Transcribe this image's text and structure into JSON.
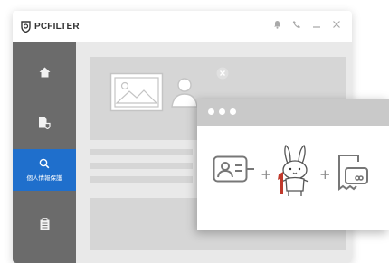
{
  "app": {
    "name": "PCFILTER"
  },
  "sidebar": {
    "items": [
      {
        "icon": "home-icon"
      },
      {
        "icon": "file-shield-icon"
      },
      {
        "icon": "search-icon",
        "label": "個人情報保護",
        "active": true
      },
      {
        "icon": "clipboard-icon"
      }
    ]
  },
  "colors": {
    "accent": "#1f6fcc",
    "sidebar": "#6b6b6b",
    "icon_stroke": "#777777",
    "highlight": "#c0392b"
  }
}
